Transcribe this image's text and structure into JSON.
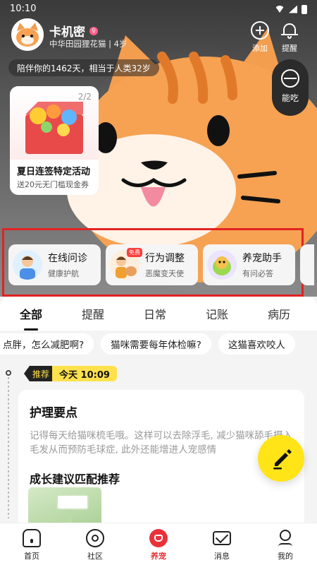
{
  "status_bar": {
    "time": "10:10"
  },
  "profile": {
    "name": "卡机密",
    "desc": "中华田园狸花猫 | 4岁",
    "companion": "陪伴你的1462天，相当于人类32岁"
  },
  "actions": {
    "add_label": "添加",
    "remind_label": "提醒",
    "eat_label": "能吃"
  },
  "promo": {
    "pages": "2/2",
    "title": "夏日连签特定活动",
    "sub": "送20元无门槛现金券"
  },
  "services": [
    {
      "title": "在线问诊",
      "sub": "健康护航"
    },
    {
      "title": "行为调整",
      "sub": "恶魔变天使",
      "badge": "免费"
    },
    {
      "title": "养宠助手",
      "sub": "有问必答"
    }
  ],
  "tabs": [
    "全部",
    "提醒",
    "日常",
    "记账",
    "病历"
  ],
  "topics": [
    "点胖，怎么减肥啊?",
    "猫咪需要每年体检嘛?",
    "这猫喜欢咬人"
  ],
  "feed": {
    "tag": "推荐",
    "time": "今天 10:09",
    "card_title": "护理要点",
    "card_text": "记得每天给猫咪梳毛哦。这样可以去除浮毛, 减少猫咪舔毛摄入毛发从而预防毛球症, 此外还能增进人宠感情",
    "card_sub": "成长建议匹配推荐"
  },
  "nav": [
    {
      "label": "首页"
    },
    {
      "label": "社区"
    },
    {
      "label": "养宠"
    },
    {
      "label": "消息"
    },
    {
      "label": "我的"
    }
  ],
  "colors": {
    "accent": "#e8323a",
    "fab": "#ffe418",
    "highlight": "#e32222"
  }
}
